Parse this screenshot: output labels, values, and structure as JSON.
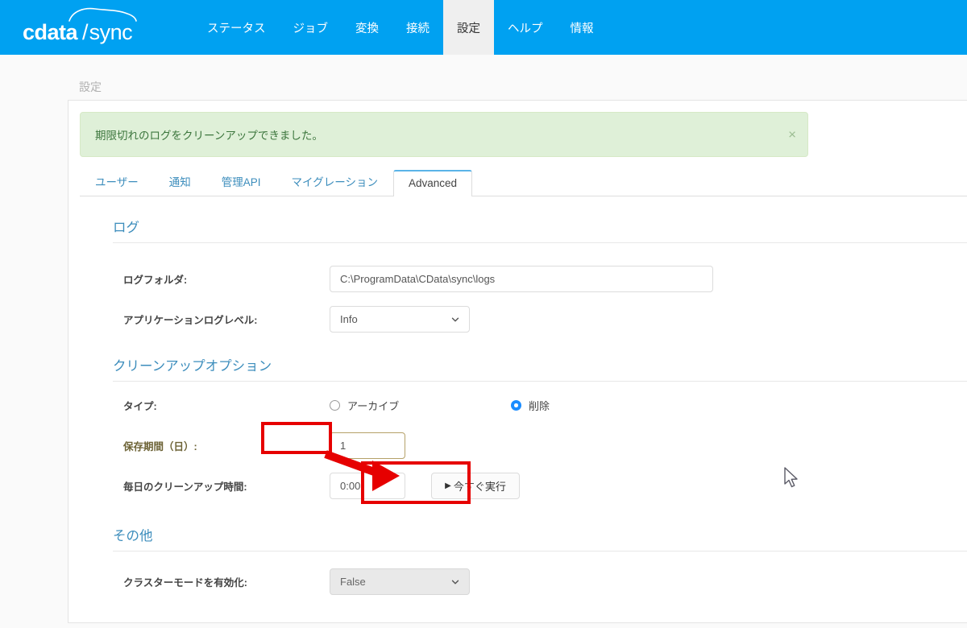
{
  "brand": {
    "name_bold": "cdata",
    "separator": "/",
    "name_light": "sync"
  },
  "navbar": {
    "items": [
      {
        "label": "ステータス",
        "active": false
      },
      {
        "label": "ジョブ",
        "active": false
      },
      {
        "label": "変換",
        "active": false
      },
      {
        "label": "接続",
        "active": false
      },
      {
        "label": "設定",
        "active": true
      },
      {
        "label": "ヘルプ",
        "active": false
      },
      {
        "label": "情報",
        "active": false
      }
    ],
    "background_color": "#00a1f1",
    "active_background_color": "#efefef"
  },
  "breadcrumb": {
    "label": "設定"
  },
  "alert": {
    "message": "期限切れのログをクリーンアップできました。",
    "close_label": "×",
    "background_color": "#dff0d8",
    "text_color": "#3c763d"
  },
  "tabs": [
    {
      "label": "ユーザー",
      "active": false
    },
    {
      "label": "通知",
      "active": false
    },
    {
      "label": "管理API",
      "active": false
    },
    {
      "label": "マイグレーション",
      "active": false
    },
    {
      "label": "Advanced",
      "active": true
    }
  ],
  "sections": {
    "log": {
      "title": "ログ",
      "folder_label": "ログフォルダ:",
      "folder_value": "C:\\ProgramData\\CData\\sync\\logs",
      "level_label": "アプリケーションログレベル:",
      "level_value": "Info"
    },
    "cleanup": {
      "title": "クリーンアップオプション",
      "type_label": "タイプ:",
      "type_options": [
        {
          "label": "アーカイブ",
          "selected": false
        },
        {
          "label": "削除",
          "selected": true
        }
      ],
      "retention_label": "保存期間（日）:",
      "retention_value": "1",
      "daily_time_label": "毎日のクリーンアップ時間:",
      "daily_time_value": "0:00",
      "run_now_label": "今すぐ実行",
      "run_now_icon": "play-triangle"
    },
    "other": {
      "title": "その他",
      "cluster_label": "クラスターモードを有効化:",
      "cluster_value": "False"
    }
  },
  "annotations": {
    "highlight_color": "#e60000",
    "retention_box": true,
    "run_button_box": true,
    "arrow": "arrow-pointing-right-to-run-button"
  }
}
